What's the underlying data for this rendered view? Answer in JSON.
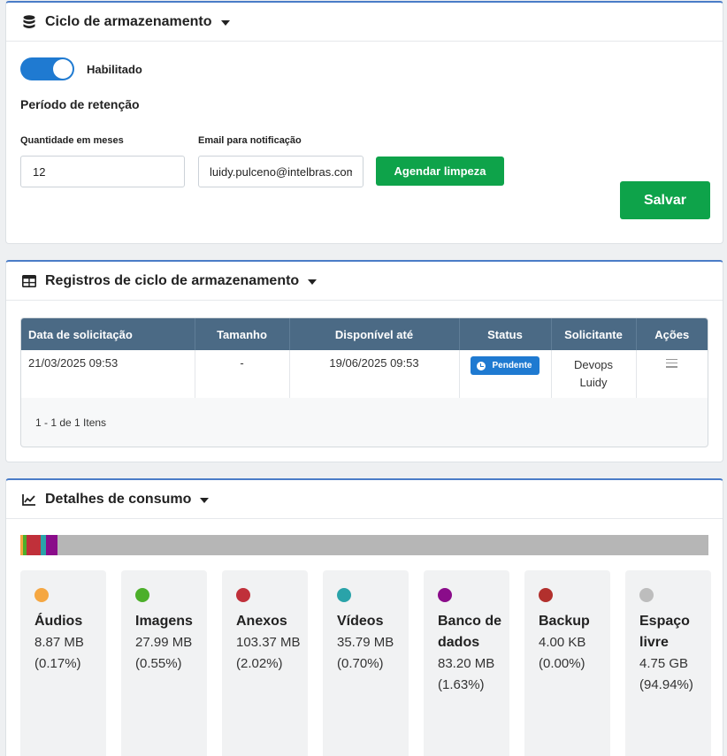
{
  "storage_cycle": {
    "title": "Ciclo de armazenamento",
    "toggle_label": "Habilitado",
    "retention_title": "Período de retenção",
    "months_label": "Quantidade em meses",
    "months_value": "12",
    "email_label": "Email para notificação",
    "email_value": "luidy.pulceno@intelbras.com",
    "schedule_button": "Agendar limpeza",
    "save_button": "Salvar"
  },
  "records": {
    "title": "Registros de ciclo de armazenamento",
    "columns": [
      "Data de solicitação",
      "Tamanho",
      "Disponível até",
      "Status",
      "Solicitante",
      "Ações"
    ],
    "rows": [
      {
        "date": "21/03/2025 09:53",
        "size": "-",
        "available_until": "19/06/2025 09:53",
        "status": "Pendente",
        "requester_line1": "Devops",
        "requester_line2": "Luidy"
      }
    ],
    "pager": "1 - 1 de 1 Itens"
  },
  "consumption": {
    "title": "Detalhes de consumo",
    "items": [
      {
        "name": "Áudios",
        "value": "8.87 MB",
        "percent": "(0.17%)",
        "color": "#f5a742",
        "share": 0.17
      },
      {
        "name": "Imagens",
        "value": "27.99 MB",
        "percent": "(0.55%)",
        "color": "#4caf2a",
        "share": 0.55
      },
      {
        "name": "Anexos",
        "value": "103.37 MB",
        "percent": "(2.02%)",
        "color": "#c0303a",
        "share": 2.02
      },
      {
        "name": "Vídeos",
        "value": "35.79 MB",
        "percent": "(0.70%)",
        "color": "#2aa3a9",
        "share": 0.7
      },
      {
        "name": "Banco de dados",
        "value": "83.20 MB",
        "percent": "(1.63%)",
        "color": "#8a0c8a",
        "share": 1.63
      },
      {
        "name": "Backup",
        "value": "4.00 KB",
        "percent": "(0.00%)",
        "color": "#b2302d",
        "share": 0.0
      },
      {
        "name": "Espaço livre",
        "value": "4.75 GB",
        "percent": "(94.94%)",
        "color": "#bdbdbd",
        "share": 94.94
      }
    ]
  }
}
